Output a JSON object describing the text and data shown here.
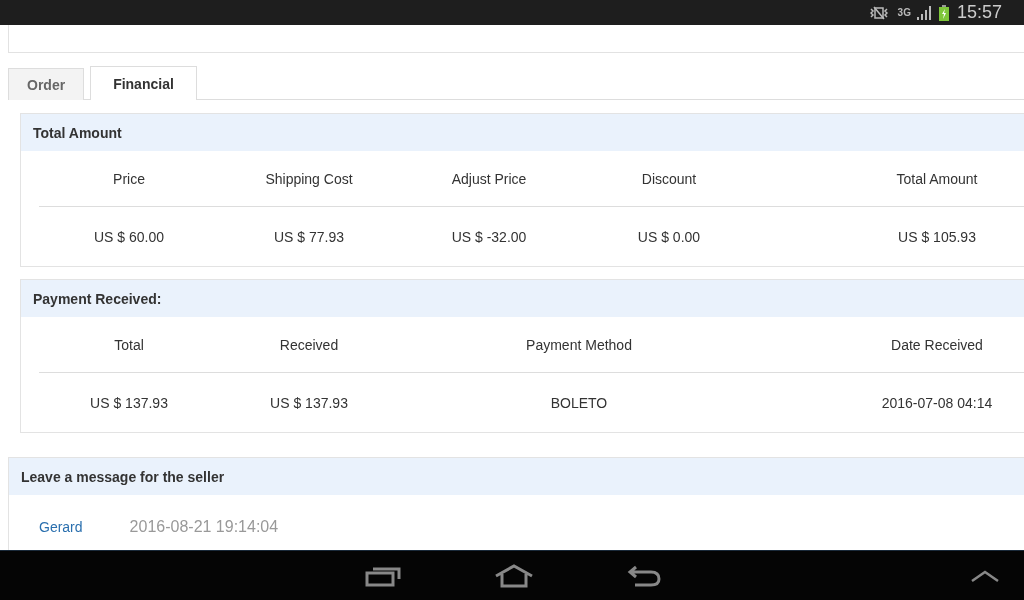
{
  "status_bar": {
    "network": "3G",
    "time": "15:57"
  },
  "tabs": [
    {
      "label": "Order",
      "selected": false
    },
    {
      "label": "Financial",
      "selected": true
    }
  ],
  "sections": [
    {
      "title": "Total Amount",
      "columns": [
        "Price",
        "Shipping Cost",
        "Adjust Price",
        "Discount",
        "Total Amount"
      ],
      "values": [
        "US $ 60.00",
        "US $ 77.93",
        "US $ -32.00",
        "US $ 0.00",
        "US $ 105.93"
      ]
    },
    {
      "title": "Payment Received:",
      "columns": [
        "Total",
        "Received",
        "Payment Method",
        "Date Received"
      ],
      "values": [
        "US $ 137.93",
        "US $ 137.93",
        "BOLETO",
        "2016-07-08 04:14"
      ]
    }
  ],
  "message_panel": {
    "title": "Leave a message for the seller",
    "author": "Gerard",
    "date": "2016-08-21 19:14:04"
  }
}
